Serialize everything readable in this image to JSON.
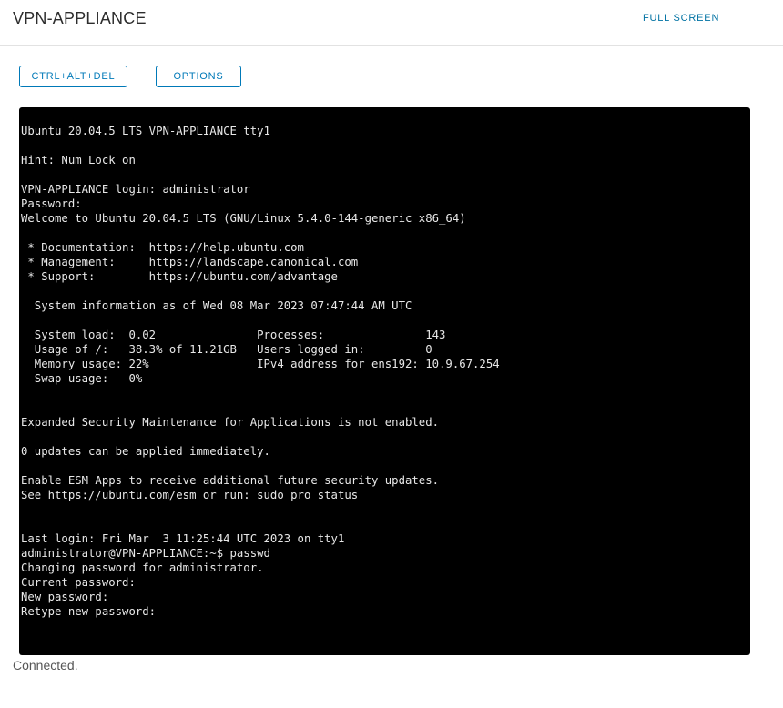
{
  "header": {
    "title": "VPN-APPLIANCE",
    "full_screen_label": "FULL SCREEN"
  },
  "toolbar": {
    "ctrl_alt_del_label": "CTRL+ALT+DEL",
    "options_label": "OPTIONS"
  },
  "console": {
    "lines": [
      "Ubuntu 20.04.5 LTS VPN-APPLIANCE tty1",
      "",
      "Hint: Num Lock on",
      "",
      "VPN-APPLIANCE login: administrator",
      "Password:",
      "Welcome to Ubuntu 20.04.5 LTS (GNU/Linux 5.4.0-144-generic x86_64)",
      "",
      " * Documentation:  https://help.ubuntu.com",
      " * Management:     https://landscape.canonical.com",
      " * Support:        https://ubuntu.com/advantage",
      "",
      "  System information as of Wed 08 Mar 2023 07:47:44 AM UTC",
      "",
      "  System load:  0.02               Processes:               143",
      "  Usage of /:   38.3% of 11.21GB   Users logged in:         0",
      "  Memory usage: 22%                IPv4 address for ens192: 10.9.67.254",
      "  Swap usage:   0%",
      "",
      "",
      "Expanded Security Maintenance for Applications is not enabled.",
      "",
      "0 updates can be applied immediately.",
      "",
      "Enable ESM Apps to receive additional future security updates.",
      "See https://ubuntu.com/esm or run: sudo pro status",
      "",
      "",
      "Last login: Fri Mar  3 11:25:44 UTC 2023 on tty1",
      "administrator@VPN-APPLIANCE:~$ passwd",
      "Changing password for administrator.",
      "Current password:",
      "New password:",
      "Retype new password:"
    ]
  },
  "status": {
    "text": "Connected."
  }
}
